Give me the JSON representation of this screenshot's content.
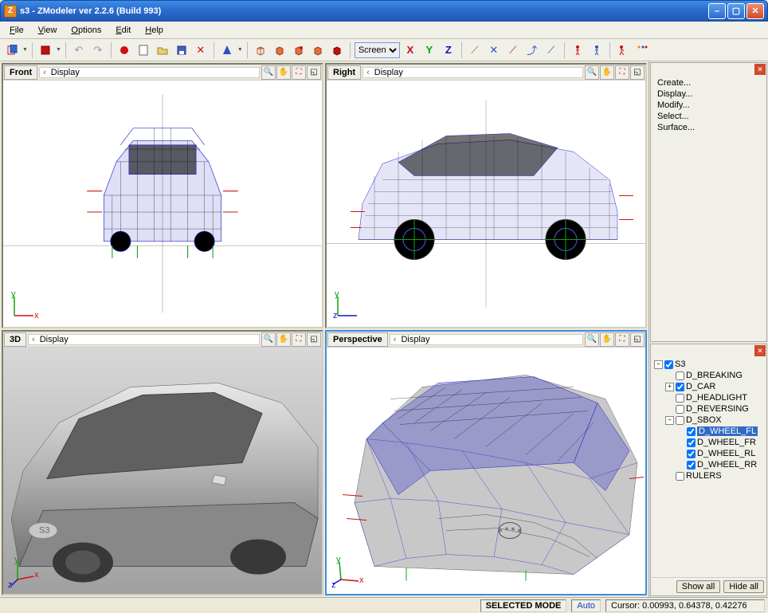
{
  "window": {
    "title": "s3 - ZModeler ver 2.2.6 (Build 993)"
  },
  "menu": {
    "file": "File",
    "view": "View",
    "options": "Options",
    "edit": "Edit",
    "help": "Help"
  },
  "toolbar": {
    "screen_select": "Screen",
    "axis": {
      "x": "X",
      "y": "Y",
      "z": "Z"
    }
  },
  "viewports": {
    "display_label": "Display",
    "front": "Front",
    "right": "Right",
    "threed": "3D",
    "perspective": "Perspective"
  },
  "command_panel": {
    "items": [
      "Create...",
      "Display...",
      "Modify...",
      "Select...",
      "Surface..."
    ]
  },
  "scene_tree": {
    "root": {
      "label": "S3",
      "checked": true,
      "expanded": true
    },
    "children": [
      {
        "label": "D_BREAKING",
        "checked": false,
        "expanded": false,
        "indent": 1
      },
      {
        "label": "D_CAR",
        "checked": true,
        "expanded": false,
        "indent": 1,
        "has_children": true
      },
      {
        "label": "D_HEADLIGHT",
        "checked": false,
        "expanded": false,
        "indent": 1
      },
      {
        "label": "D_REVERSING",
        "checked": false,
        "expanded": false,
        "indent": 1
      },
      {
        "label": "D_SBOX",
        "checked": false,
        "expanded": true,
        "indent": 1,
        "has_children": true
      },
      {
        "label": "D_WHEEL_FL",
        "checked": true,
        "expanded": false,
        "indent": 2,
        "selected": true
      },
      {
        "label": "D_WHEEL_FR",
        "checked": true,
        "expanded": false,
        "indent": 2
      },
      {
        "label": "D_WHEEL_RL",
        "checked": true,
        "expanded": false,
        "indent": 2
      },
      {
        "label": "D_WHEEL_RR",
        "checked": true,
        "expanded": false,
        "indent": 2
      },
      {
        "label": "RULERS",
        "checked": false,
        "expanded": false,
        "indent": 1
      }
    ],
    "buttons": {
      "show_all": "Show all",
      "hide_all": "Hide all"
    }
  },
  "status": {
    "mode": "SELECTED MODE",
    "auto": "Auto",
    "cursor": "Cursor: 0.00993, 0.64378, 0.42276"
  }
}
